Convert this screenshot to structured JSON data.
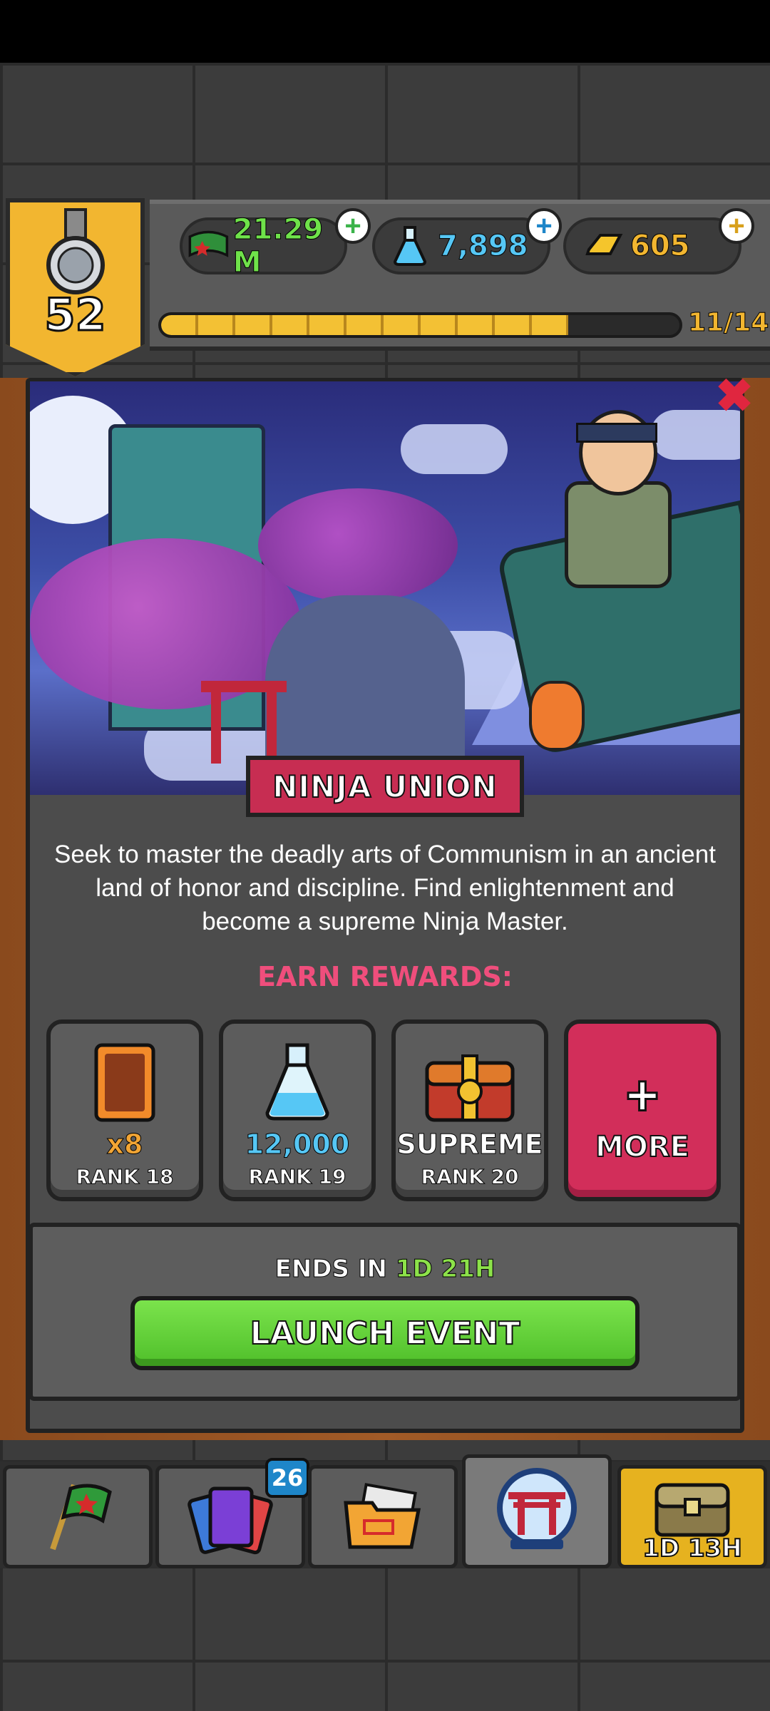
{
  "hud": {
    "level": "52",
    "cash": "21.29 M",
    "science": "7,898",
    "gold": "605",
    "xp_label": "11/14",
    "xp_progress": 0.786
  },
  "event": {
    "title": "NINJA UNION",
    "description": "Seek to master the deadly arts of Communism in an ancient land of honor and discipline. Find enlightenment and become a supreme Ninja Master.",
    "earn_label": "EARN REWARDS:",
    "rewards": [
      {
        "value": "x8",
        "rank": "RANK 18",
        "color": "#f2a534"
      },
      {
        "value": "12,000",
        "rank": "RANK 19",
        "color": "#56c7f5"
      },
      {
        "value": "SUPREME",
        "rank": "RANK 20",
        "color": "#ffffff"
      }
    ],
    "more_plus": "+",
    "more_label": "MORE",
    "ends_prefix": "ENDS IN ",
    "ends_time": "1D 21H",
    "launch_label": "LAUNCH EVENT"
  },
  "nav": {
    "cards_badge": "26",
    "chest_timer": "1D 13H"
  },
  "colors": {
    "accent_gold": "#f2b630",
    "accent_pink": "#d22e5a",
    "accent_green": "#5cc93a",
    "cash_green": "#6fe24a",
    "science_blue": "#56c7f5"
  }
}
